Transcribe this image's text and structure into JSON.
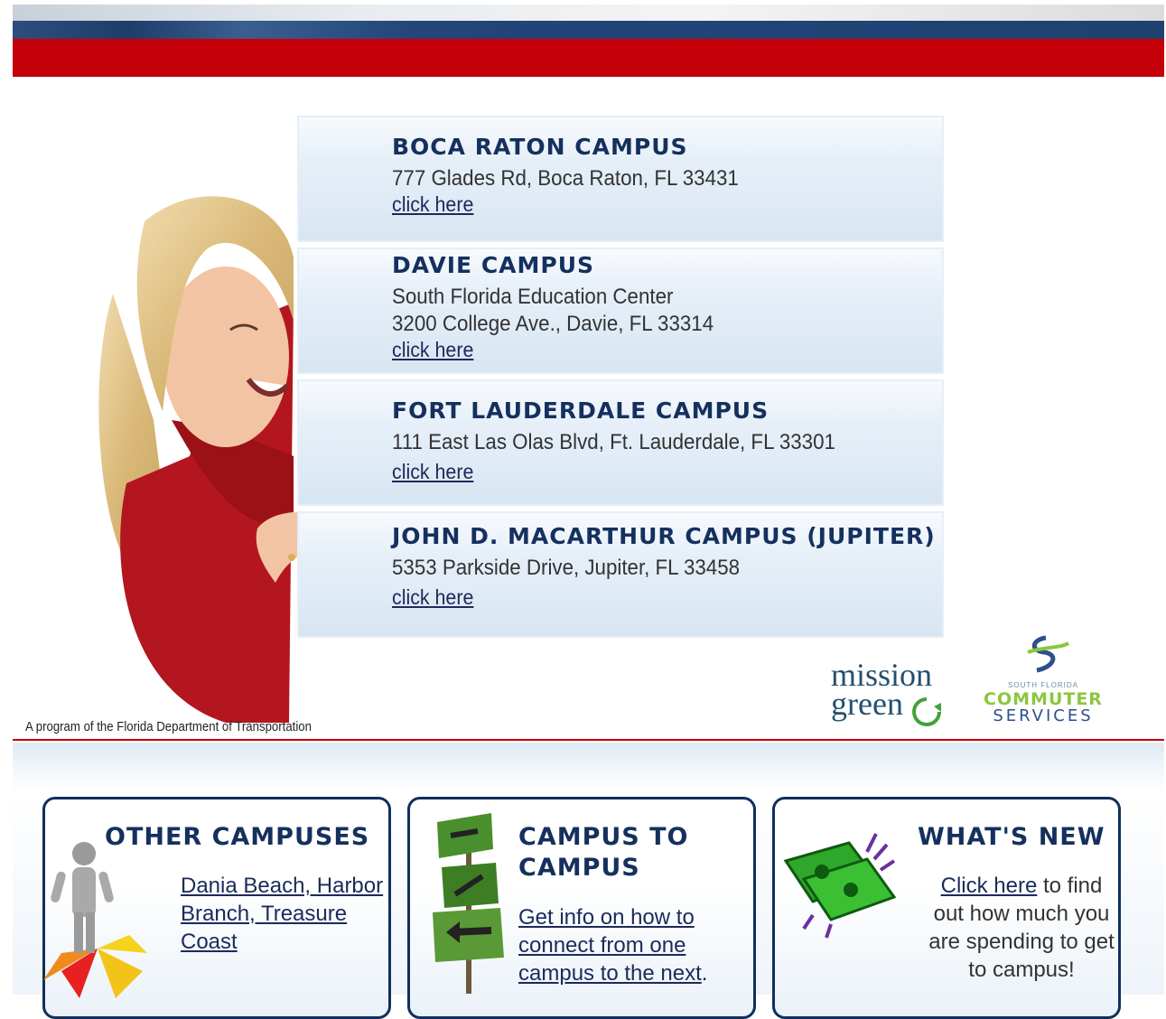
{
  "header": {
    "colors": {
      "navy": "#1e3d6b",
      "red": "#c4000b"
    }
  },
  "campuses": [
    {
      "name": "BOCA RATON CAMPUS",
      "lines": [
        "777 Glades Rd, Boca Raton, FL 33431"
      ],
      "link": "click here"
    },
    {
      "name": "DAVIE CAMPUS",
      "lines": [
        "South Florida Education Center",
        "3200 College Ave., Davie, FL 33314"
      ],
      "link": "click here"
    },
    {
      "name": "FORT LAUDERDALE CAMPUS",
      "lines": [
        "111 East Las Olas Blvd, Ft. Lauderdale, FL 33301"
      ],
      "link": "click here"
    },
    {
      "name": "JOHN D. MACARTHUR CAMPUS (JUPITER)",
      "lines": [
        "5353 Parkside Drive, Jupiter, FL 33458"
      ],
      "link": "click here"
    }
  ],
  "footer_note": "A program of the Florida Department of Transportation",
  "logos": {
    "mission_green": {
      "line1": "mission",
      "line2": "green"
    },
    "commuter": {
      "small": "SOUTH FLORIDA",
      "line1": "COMMUTER",
      "line2": "SERVICES"
    }
  },
  "boxes": {
    "other": {
      "title": "OTHER CAMPUSES",
      "link": "Dania Beach, Harbor Branch, Treasure Coast"
    },
    "c2c": {
      "title_line1": "CAMPUS TO",
      "title_line2": "CAMPUS",
      "link": "Get info on how to connect from one campus to the next",
      "after": "."
    },
    "news": {
      "title": "WHAT'S NEW",
      "link": "Click here",
      "after": " to find out how much you are spending to get to campus!"
    }
  },
  "icons": [
    "woman-photo",
    "person-arrows-icon",
    "road-signs-icon",
    "money-icon",
    "mission-green-logo",
    "commuter-services-logo"
  ]
}
